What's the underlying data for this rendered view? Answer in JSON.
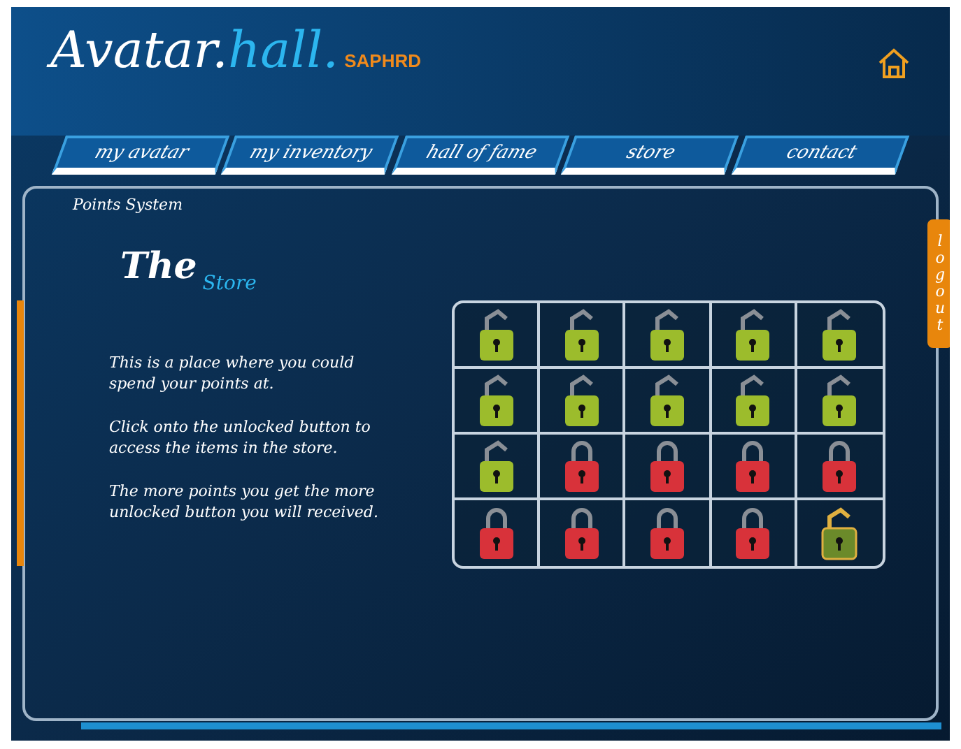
{
  "logo": {
    "part_1": "Avatar.",
    "part_2": "hall.",
    "part_3": "SAPHRD"
  },
  "nav": [
    {
      "label": "my avatar"
    },
    {
      "label": "my inventory"
    },
    {
      "label": "hall of fame"
    },
    {
      "label": "store"
    },
    {
      "label": "contact"
    }
  ],
  "breadcrumb": "Points System",
  "heading": {
    "line_1": "The",
    "line_2": "Store"
  },
  "paragraphs": [
    "This is a place where you could spend your points at.",
    "Click onto the unlocked button to access the items in the store.",
    "The more points you get the more unlocked button you will received."
  ],
  "logout": "logout",
  "locks": [
    {
      "locked": false,
      "selected": false
    },
    {
      "locked": false,
      "selected": false
    },
    {
      "locked": false,
      "selected": false
    },
    {
      "locked": false,
      "selected": false
    },
    {
      "locked": false,
      "selected": false
    },
    {
      "locked": false,
      "selected": false
    },
    {
      "locked": false,
      "selected": false
    },
    {
      "locked": false,
      "selected": false
    },
    {
      "locked": false,
      "selected": false
    },
    {
      "locked": false,
      "selected": false
    },
    {
      "locked": false,
      "selected": false
    },
    {
      "locked": true,
      "selected": false
    },
    {
      "locked": true,
      "selected": false
    },
    {
      "locked": true,
      "selected": false
    },
    {
      "locked": true,
      "selected": false
    },
    {
      "locked": true,
      "selected": false
    },
    {
      "locked": true,
      "selected": false
    },
    {
      "locked": true,
      "selected": false
    },
    {
      "locked": true,
      "selected": false
    },
    {
      "locked": false,
      "selected": true
    }
  ]
}
